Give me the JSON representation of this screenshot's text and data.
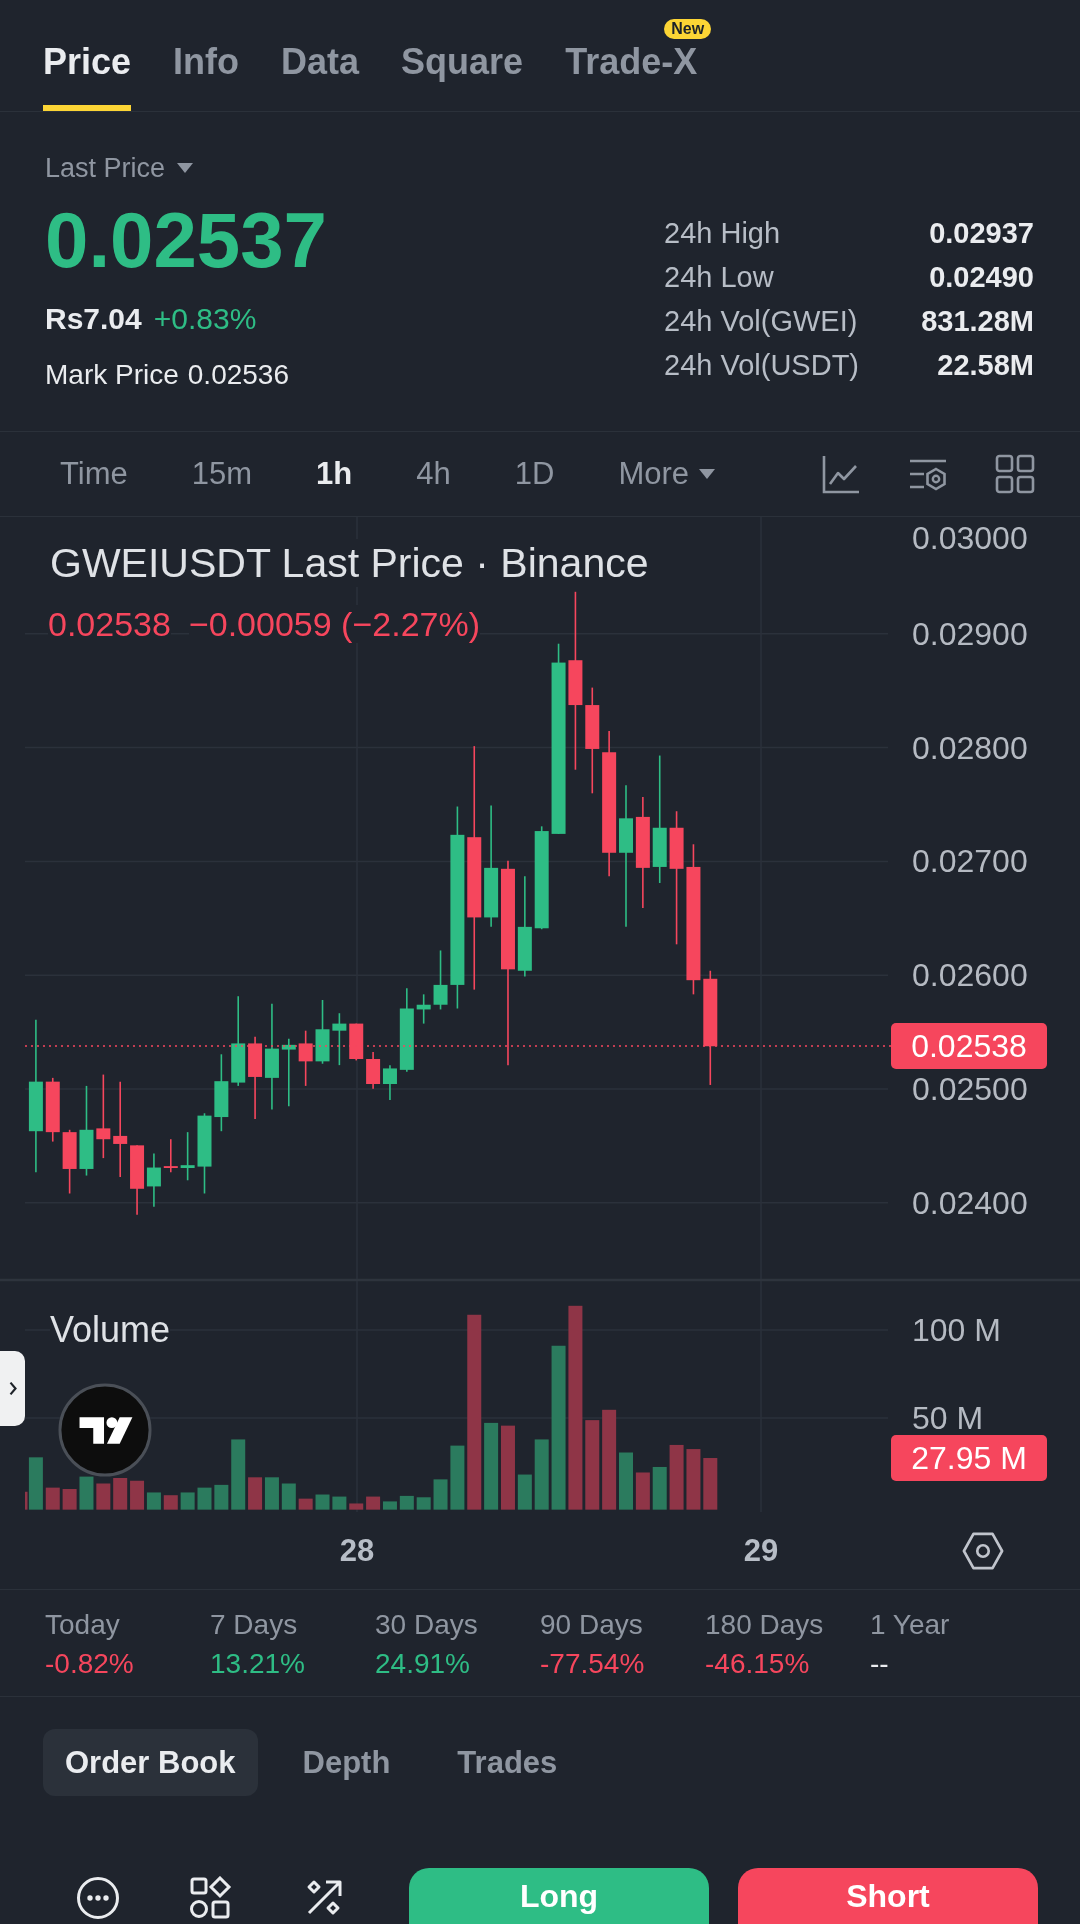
{
  "tabs": [
    {
      "label": "Price",
      "selected": true
    },
    {
      "label": "Info",
      "selected": false
    },
    {
      "label": "Data",
      "selected": false
    },
    {
      "label": "Square",
      "selected": false
    },
    {
      "label": "Trade-X",
      "selected": false,
      "badge": "New"
    }
  ],
  "summary": {
    "price_type": "Last Price",
    "last_price": "0.02537",
    "local_price": "Rs7.04",
    "change": "+0.83%",
    "mark_price_label": "Mark Price",
    "mark_price": "0.02536",
    "stats": [
      {
        "label": "24h High",
        "value": "0.02937"
      },
      {
        "label": "24h Low",
        "value": "0.02490"
      },
      {
        "label": "24h Vol(GWEI)",
        "value": "831.28M"
      },
      {
        "label": "24h Vol(USDT)",
        "value": "22.58M"
      }
    ]
  },
  "intervals": {
    "items": [
      {
        "label": "Time",
        "selected": false
      },
      {
        "label": "15m",
        "selected": false
      },
      {
        "label": "1h",
        "selected": true
      },
      {
        "label": "4h",
        "selected": false
      },
      {
        "label": "1D",
        "selected": false
      }
    ],
    "more": "More"
  },
  "chart": {
    "title": "GWEIUSDT Last Price · Binance",
    "legend_price": "0.02538",
    "legend_change": "−0.00059 (−2.27%)",
    "price_ticks": [
      "0.03000",
      "0.02900",
      "0.02800",
      "0.02700",
      "0.02600",
      "0.02500",
      "0.02400"
    ],
    "price_tag": "0.02538",
    "volume_label": "Volume",
    "volume_ticks": [
      "100 M",
      "50 M"
    ],
    "volume_tag": "27.95 M",
    "date_ticks": [
      "28",
      "29"
    ]
  },
  "performance": [
    {
      "label": "Today",
      "value": "-0.82%",
      "color": "#f6465d"
    },
    {
      "label": "7 Days",
      "value": "13.21%",
      "color": "#2ebd85"
    },
    {
      "label": "30 Days",
      "value": "24.91%",
      "color": "#2ebd85"
    },
    {
      "label": "90 Days",
      "value": "-77.54%",
      "color": "#f6465d"
    },
    {
      "label": "180 Days",
      "value": "-46.15%",
      "color": "#f6465d"
    },
    {
      "label": "1 Year",
      "value": "--",
      "color": "#eaecef"
    }
  ],
  "book_tabs": [
    {
      "label": "Order Book",
      "selected": true
    },
    {
      "label": "Depth",
      "selected": false
    },
    {
      "label": "Trades",
      "selected": false
    }
  ],
  "actions": [
    {
      "label": "Long",
      "kind": "long"
    },
    {
      "label": "Short",
      "kind": "short"
    }
  ]
}
